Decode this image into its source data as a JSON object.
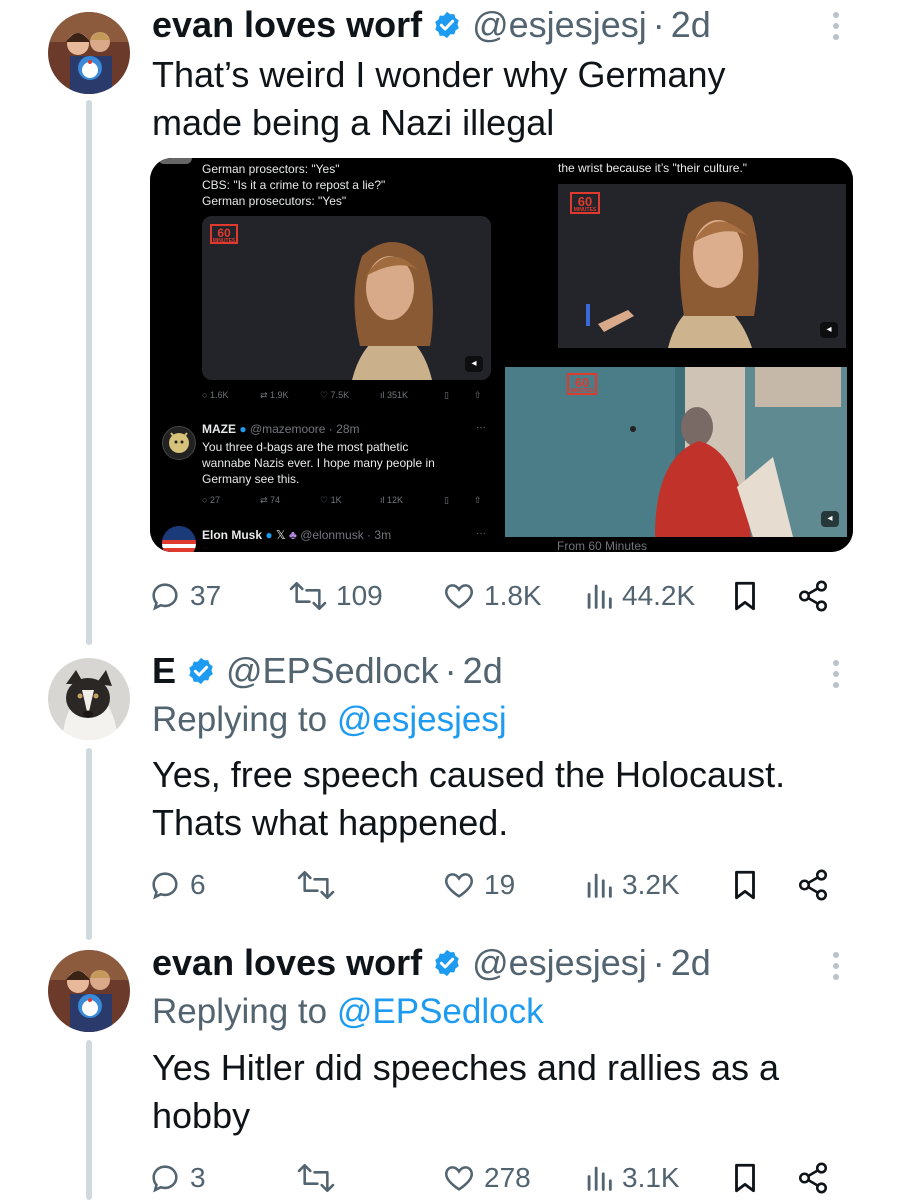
{
  "tweets": [
    {
      "author": "evan loves worf",
      "handle": "@esjesjesj",
      "dot": "·",
      "time": "2d",
      "text_lines": [
        "That’s weird I wonder why Germany",
        "made being a Nazi illegal"
      ],
      "stats": {
        "replies": "37",
        "retweets": "109",
        "likes": "1.8K",
        "views": "44.2K"
      }
    },
    {
      "author": "E",
      "handle": "@EPSedlock",
      "dot": "·",
      "time": "2d",
      "replying_prefix": "Replying to",
      "replying_to": "@esjesjesj",
      "text_lines": [
        "Yes, free speech caused the Holocaust.",
        "Thats what happened."
      ],
      "stats": {
        "replies": "6",
        "retweets": "",
        "likes": "19",
        "views": "3.2K"
      }
    },
    {
      "author": "evan loves worf",
      "handle": "@esjesjesj",
      "dot": "·",
      "time": "2d",
      "replying_prefix": "Replying to",
      "replying_to": "@EPSedlock",
      "text_lines": [
        "Yes Hitler did speeches and rallies as a",
        "hobby"
      ],
      "stats": {
        "replies": "3",
        "retweets": "",
        "likes": "278",
        "views": "3.1K"
      }
    }
  ],
  "media": {
    "left_panel": {
      "caption_lines": [
        "German prosectors: \"Yes\"",
        "CBS: \"Is it a crime to repost a lie?\"",
        "German prosecutors: \"Yes\""
      ],
      "logo_num": "60",
      "logo_sub": "MINUTES",
      "stats": {
        "replies": "1.6K",
        "retweets": "1.9K",
        "likes": "7.5K",
        "views": "351K"
      },
      "reply_author": "MAZE",
      "reply_handle": "@mazemoore · 28m",
      "reply_text_lines": [
        "You three d-bags are the most pathetic",
        "wannabe Nazis ever. I hope many people in",
        "Germany see this."
      ],
      "reply_stats": {
        "replies": "27",
        "retweets": "74",
        "likes": "1K",
        "views": "12K"
      },
      "next_author": "Elon Musk",
      "next_handle": "@elonmusk · 3m"
    },
    "top_right_panel": {
      "caption": "the wrist because it’s \"their culture.\"",
      "logo_num": "60",
      "logo_sub": "MINUTES"
    },
    "bottom_right_panel": {
      "logo_num": "60",
      "logo_sub": "MINUTES",
      "footer": "From 60 Minutes"
    }
  },
  "colors": {
    "accent_blue": "#1d9bf0",
    "text_primary": "#0f1419",
    "text_secondary": "#536471",
    "thread_line": "#cfd9de",
    "logo_red": "#e03a2f"
  }
}
